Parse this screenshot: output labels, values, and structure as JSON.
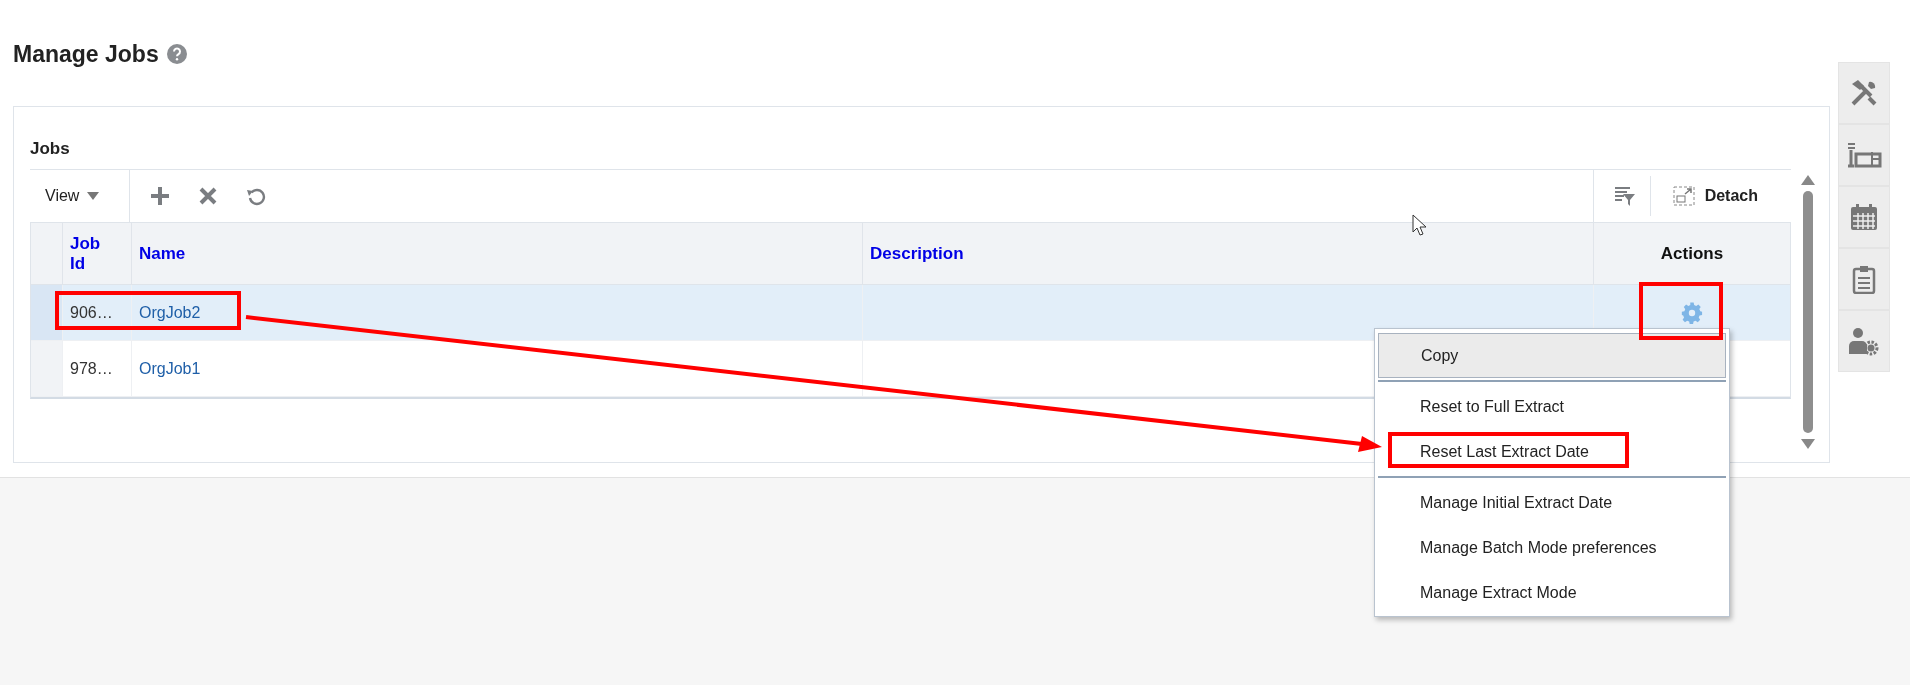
{
  "page": {
    "title": "Manage Jobs"
  },
  "panel": {
    "title": "Jobs",
    "toolbar": {
      "view_label": "View",
      "detach_label": "Detach"
    },
    "columns": [
      {
        "label": "Job Id",
        "kind": "sortable"
      },
      {
        "label": "Name",
        "kind": "sortable"
      },
      {
        "label": "Description",
        "kind": "sortable"
      },
      {
        "label": "Actions",
        "kind": "plain"
      }
    ],
    "rows": [
      {
        "job_id": "906…",
        "name": "OrgJob2",
        "selected": true
      },
      {
        "job_id": "978…",
        "name": "OrgJob1",
        "selected": false
      }
    ]
  },
  "action_menu": {
    "groups": [
      [
        {
          "label": "Copy",
          "selected": true
        }
      ],
      [
        {
          "label": "Reset to Full Extract",
          "selected": false
        },
        {
          "label": "Reset Last Extract Date",
          "selected": false
        }
      ],
      [
        {
          "label": "Manage Initial Extract Date",
          "selected": false
        },
        {
          "label": "Manage Batch Mode preferences",
          "selected": false
        },
        {
          "label": "Manage Extract Mode",
          "selected": false
        }
      ]
    ]
  },
  "annotations": {
    "row_frame": true,
    "actions_frame": true,
    "menu_item_frame": true,
    "arrow": true
  }
}
